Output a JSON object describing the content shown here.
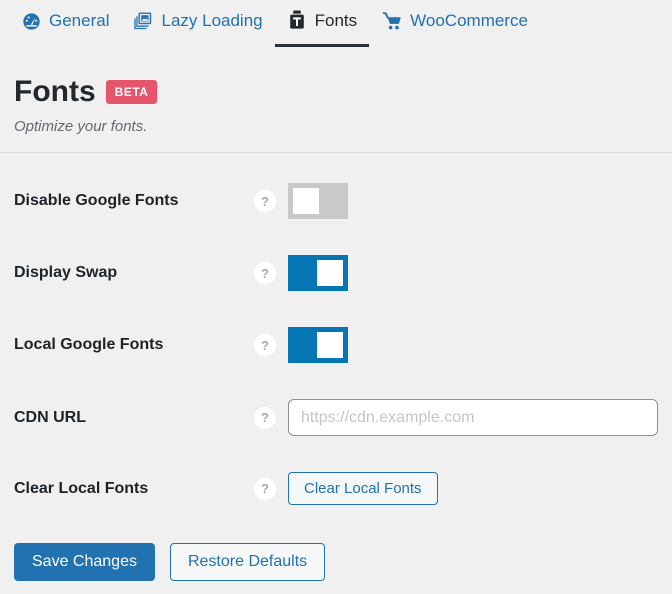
{
  "tabs": [
    {
      "label": "General",
      "icon": "dashboard-icon",
      "active": false
    },
    {
      "label": "Lazy Loading",
      "icon": "images-icon",
      "active": false
    },
    {
      "label": "Fonts",
      "icon": "fonts-icon",
      "active": true
    },
    {
      "label": "WooCommerce",
      "icon": "cart-icon",
      "active": false
    }
  ],
  "header": {
    "title": "Fonts",
    "badge": "BETA",
    "subtitle": "Optimize your fonts."
  },
  "glyphs": {
    "help": "?"
  },
  "settings": [
    {
      "label": "Disable Google Fonts",
      "type": "toggle",
      "state": "off"
    },
    {
      "label": "Display Swap",
      "type": "toggle",
      "state": "on"
    },
    {
      "label": "Local Google Fonts",
      "type": "toggle",
      "state": "on"
    },
    {
      "label": "CDN URL",
      "type": "input",
      "value": "",
      "placeholder": "https://cdn.example.com"
    },
    {
      "label": "Clear Local Fonts",
      "type": "button",
      "button_label": "Clear Local Fonts"
    }
  ],
  "footer": {
    "save_label": "Save Changes",
    "restore_label": "Restore Defaults"
  },
  "colors": {
    "accent_blue": "#2271b1",
    "toggle_on": "#0675b4",
    "toggle_off": "#c8c9ca",
    "beta_badge": "#e5566c",
    "active_tab": "#23282d",
    "background": "#f0f0f1",
    "divider": "#dcdcde"
  }
}
